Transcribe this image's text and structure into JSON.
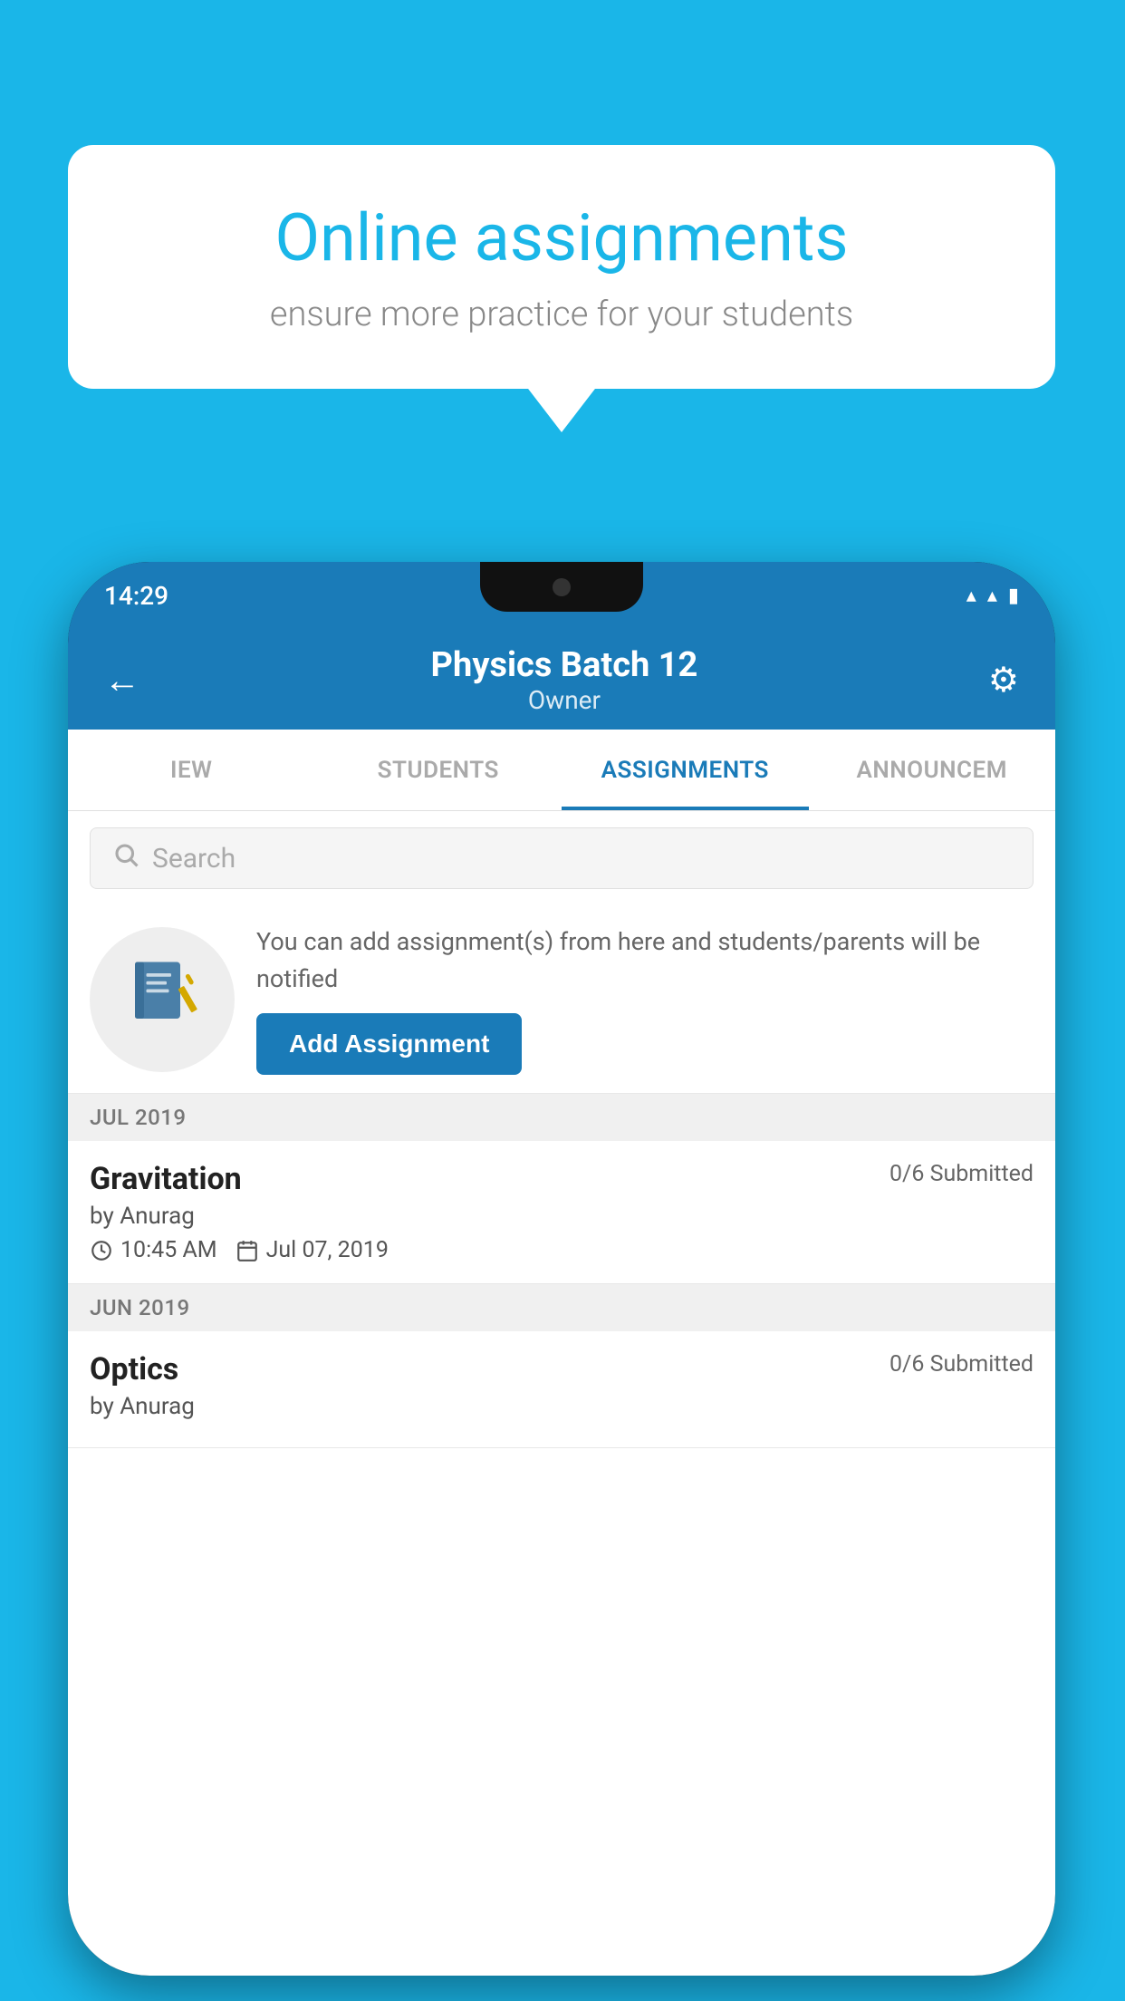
{
  "background_color": "#1ab6e8",
  "speech_bubble": {
    "title": "Online assignments",
    "subtitle": "ensure more practice for your students"
  },
  "phone": {
    "status_bar": {
      "time": "14:29",
      "icons": [
        "wifi",
        "signal",
        "battery"
      ]
    },
    "app_bar": {
      "title": "Physics Batch 12",
      "subtitle": "Owner",
      "back_label": "←",
      "settings_label": "⚙"
    },
    "tabs": [
      {
        "label": "IEW",
        "active": false
      },
      {
        "label": "STUDENTS",
        "active": false
      },
      {
        "label": "ASSIGNMENTS",
        "active": true
      },
      {
        "label": "ANNOUNCEM",
        "active": false
      }
    ],
    "search": {
      "placeholder": "Search"
    },
    "promo": {
      "description": "You can add assignment(s) from here and students/parents will be notified",
      "button_label": "Add Assignment"
    },
    "sections": [
      {
        "month": "JUL 2019",
        "assignments": [
          {
            "name": "Gravitation",
            "submitted": "0/6 Submitted",
            "by": "by Anurag",
            "time": "10:45 AM",
            "date": "Jul 07, 2019"
          }
        ]
      },
      {
        "month": "JUN 2019",
        "assignments": [
          {
            "name": "Optics",
            "submitted": "0/6 Submitted",
            "by": "by Anurag",
            "time": "",
            "date": ""
          }
        ]
      }
    ]
  }
}
